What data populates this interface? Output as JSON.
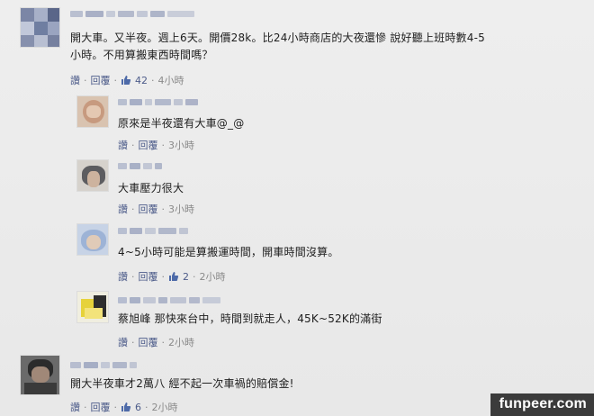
{
  "comments": [
    {
      "text_line1": "開大車。又半夜。週上6天。開價28k。比24小時商店的大夜還慘 說好聽上班時數4-5",
      "text_line2": "小時。不用算搬東西時間嗎？",
      "reply_label": "讚",
      "reply_action": "回覆",
      "likes": "42",
      "time": "4小時"
    },
    {
      "text": "原來是半夜還有大車@_@",
      "reply_label": "讚",
      "reply_action": "回覆",
      "time": "3小時"
    },
    {
      "text": "大車壓力很大",
      "reply_label": "讚",
      "reply_action": "回覆",
      "time": "3小時"
    },
    {
      "text": "4~5小時可能是算搬運時間，開車時間沒算。",
      "reply_label": "讚",
      "reply_action": "回覆",
      "likes": "2",
      "time": "2小時"
    },
    {
      "text": "蔡旭峰 那快來台中，時間到就走人，45K~52K的滿街",
      "reply_label": "讚",
      "reply_action": "回覆",
      "time": "2小時"
    },
    {
      "text": "開大半夜車才2萬八 經不起一次車禍的賠償金!",
      "reply_label": "讚",
      "reply_action": "回覆",
      "likes": "6",
      "time": "2小時"
    }
  ],
  "icons": {
    "like": "thumbs-up-icon"
  },
  "watermark": "funpeer.com",
  "colors": {
    "link": "#4d5c8a",
    "background": "#ebebeb",
    "watermark_bg": "#3b3b3b"
  }
}
